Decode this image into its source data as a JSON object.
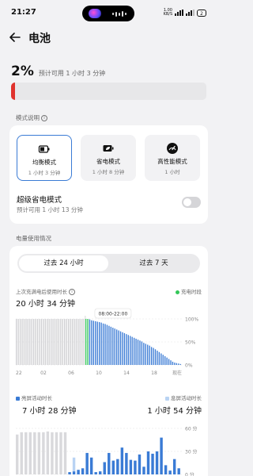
{
  "status_bar": {
    "time": "21:27",
    "net_speed_value": "1.00",
    "net_speed_unit": "KB/S",
    "battery_text": "2"
  },
  "header": {
    "title": "电池"
  },
  "battery": {
    "percent_text": "2%",
    "level_fraction": 0.02,
    "estimate": "预计可用 1 小时 3 分钟",
    "bar_color": "#e0322d"
  },
  "mode_section": {
    "label": "模式说明",
    "modes": [
      {
        "name": "均衡模式",
        "sub": "1 小时 3 分钟",
        "icon": "battery-icon",
        "selected": true
      },
      {
        "name": "省电模式",
        "sub": "1 小时 8 分钟",
        "icon": "battery-leaf-icon",
        "selected": false
      },
      {
        "name": "高性能模式",
        "sub": "1 小时",
        "icon": "speedometer-icon",
        "selected": false
      }
    ],
    "super_saver": {
      "title": "超级省电模式",
      "estimate": "预计可用 1 小时 13 分钟",
      "enabled": false
    }
  },
  "usage_section": {
    "label": "电量使用情况",
    "tabs": [
      "过去 24 小时",
      "过去 7 天"
    ],
    "active_tab": 0,
    "since_charge_label": "上次充满电后使用时长",
    "since_charge_value": "20 小时 34 分钟",
    "charging_legend": "充电时段",
    "tooltip": "08:00-22:00",
    "screen_on_label": "亮屏活动时长",
    "screen_on_value": "7 小时 28 分钟",
    "screen_off_label": "息屏活动时长",
    "screen_off_value": "1 小时 54 分钟"
  },
  "colors": {
    "accent_blue": "#3a7bd5",
    "light_blue": "#b9d3f3",
    "charging_green": "#34c759",
    "past_gray": "#cfcfd2"
  },
  "chart_data": [
    {
      "type": "bar",
      "title": "",
      "x_tick_labels": [
        "22",
        "02",
        "06",
        "10",
        "14",
        "18",
        "现在"
      ],
      "y_tick_labels": [
        "100%",
        "50%",
        "0%"
      ],
      "ylim": [
        0,
        100
      ],
      "grid": true,
      "values_percent": [
        100,
        100,
        100,
        100,
        100,
        100,
        100,
        100,
        100,
        100,
        100,
        100,
        100,
        100,
        100,
        100,
        100,
        100,
        100,
        100,
        100,
        100,
        100,
        100,
        100,
        100,
        100,
        100,
        100,
        100,
        100,
        100,
        100,
        100,
        100,
        100,
        100,
        100,
        99,
        97,
        96,
        95,
        94,
        93,
        92,
        90,
        89,
        87,
        85,
        83,
        81,
        79,
        77,
        75,
        73,
        71,
        69,
        67,
        65,
        63,
        61,
        59,
        57,
        55,
        53,
        51,
        48,
        46,
        44,
        42,
        39,
        37,
        34,
        31,
        28,
        25,
        22,
        19,
        16,
        13,
        10,
        7,
        5,
        4,
        3,
        2
      ],
      "bar_state": [
        "gray",
        "gray",
        "gray",
        "gray",
        "gray",
        "gray",
        "gray",
        "gray",
        "gray",
        "gray",
        "gray",
        "gray",
        "gray",
        "gray",
        "gray",
        "gray",
        "gray",
        "gray",
        "gray",
        "gray",
        "gray",
        "gray",
        "gray",
        "gray",
        "gray",
        "gray",
        "gray",
        "gray",
        "gray",
        "gray",
        "gray",
        "gray",
        "gray",
        "gray",
        "gray",
        "gray",
        "green",
        "green",
        "blue",
        "blue",
        "blue",
        "blue",
        "blue",
        "blue",
        "blue",
        "blue",
        "blue",
        "blue",
        "blue",
        "blue",
        "blue",
        "blue",
        "blue",
        "blue",
        "blue",
        "blue",
        "blue",
        "blue",
        "blue",
        "blue",
        "blue",
        "blue",
        "blue",
        "blue",
        "blue",
        "blue",
        "blue",
        "blue",
        "blue",
        "blue",
        "blue",
        "blue",
        "blue",
        "blue",
        "blue",
        "blue",
        "blue",
        "blue",
        "blue",
        "blue",
        "blue",
        "blue",
        "blue",
        "blue",
        "blue",
        "blue"
      ],
      "tooltip_range": "08:00-22:00"
    },
    {
      "type": "bar",
      "title": "",
      "y_tick_labels": [
        "60 分",
        "30 分",
        "0 分"
      ],
      "ylim": [
        0,
        60
      ],
      "grid": true,
      "series": [
        {
          "name": "亮屏活动时长",
          "color": "#3a7bd5",
          "values": [
            0,
            0,
            0,
            0,
            0,
            0,
            0,
            0,
            0,
            0,
            0,
            0,
            3,
            4,
            6,
            8,
            28,
            22,
            3,
            4,
            16,
            28,
            18,
            20,
            35,
            28,
            19,
            18,
            26,
            10,
            30,
            27,
            30,
            48,
            12,
            5,
            20,
            8
          ]
        },
        {
          "name": "息屏活动时长",
          "color": "#b9d3f3",
          "values": [
            0,
            0,
            0,
            0,
            0,
            0,
            0,
            0,
            0,
            0,
            0,
            0,
            0,
            18,
            0,
            0,
            0,
            0,
            0,
            0,
            0,
            0,
            0,
            0,
            0,
            0,
            0,
            0,
            0,
            0,
            0,
            0,
            0,
            0,
            0,
            0,
            0,
            0
          ]
        },
        {
          "name": "",
          "color": "#d9d9dc",
          "values": [
            52,
            55,
            55,
            55,
            55,
            55,
            55,
            56,
            55,
            55,
            55,
            55,
            0,
            0,
            0,
            0,
            0,
            0,
            0,
            0,
            0,
            0,
            0,
            0,
            0,
            0,
            0,
            0,
            0,
            0,
            0,
            0,
            0,
            0,
            0,
            0,
            0,
            0
          ]
        }
      ]
    }
  ]
}
